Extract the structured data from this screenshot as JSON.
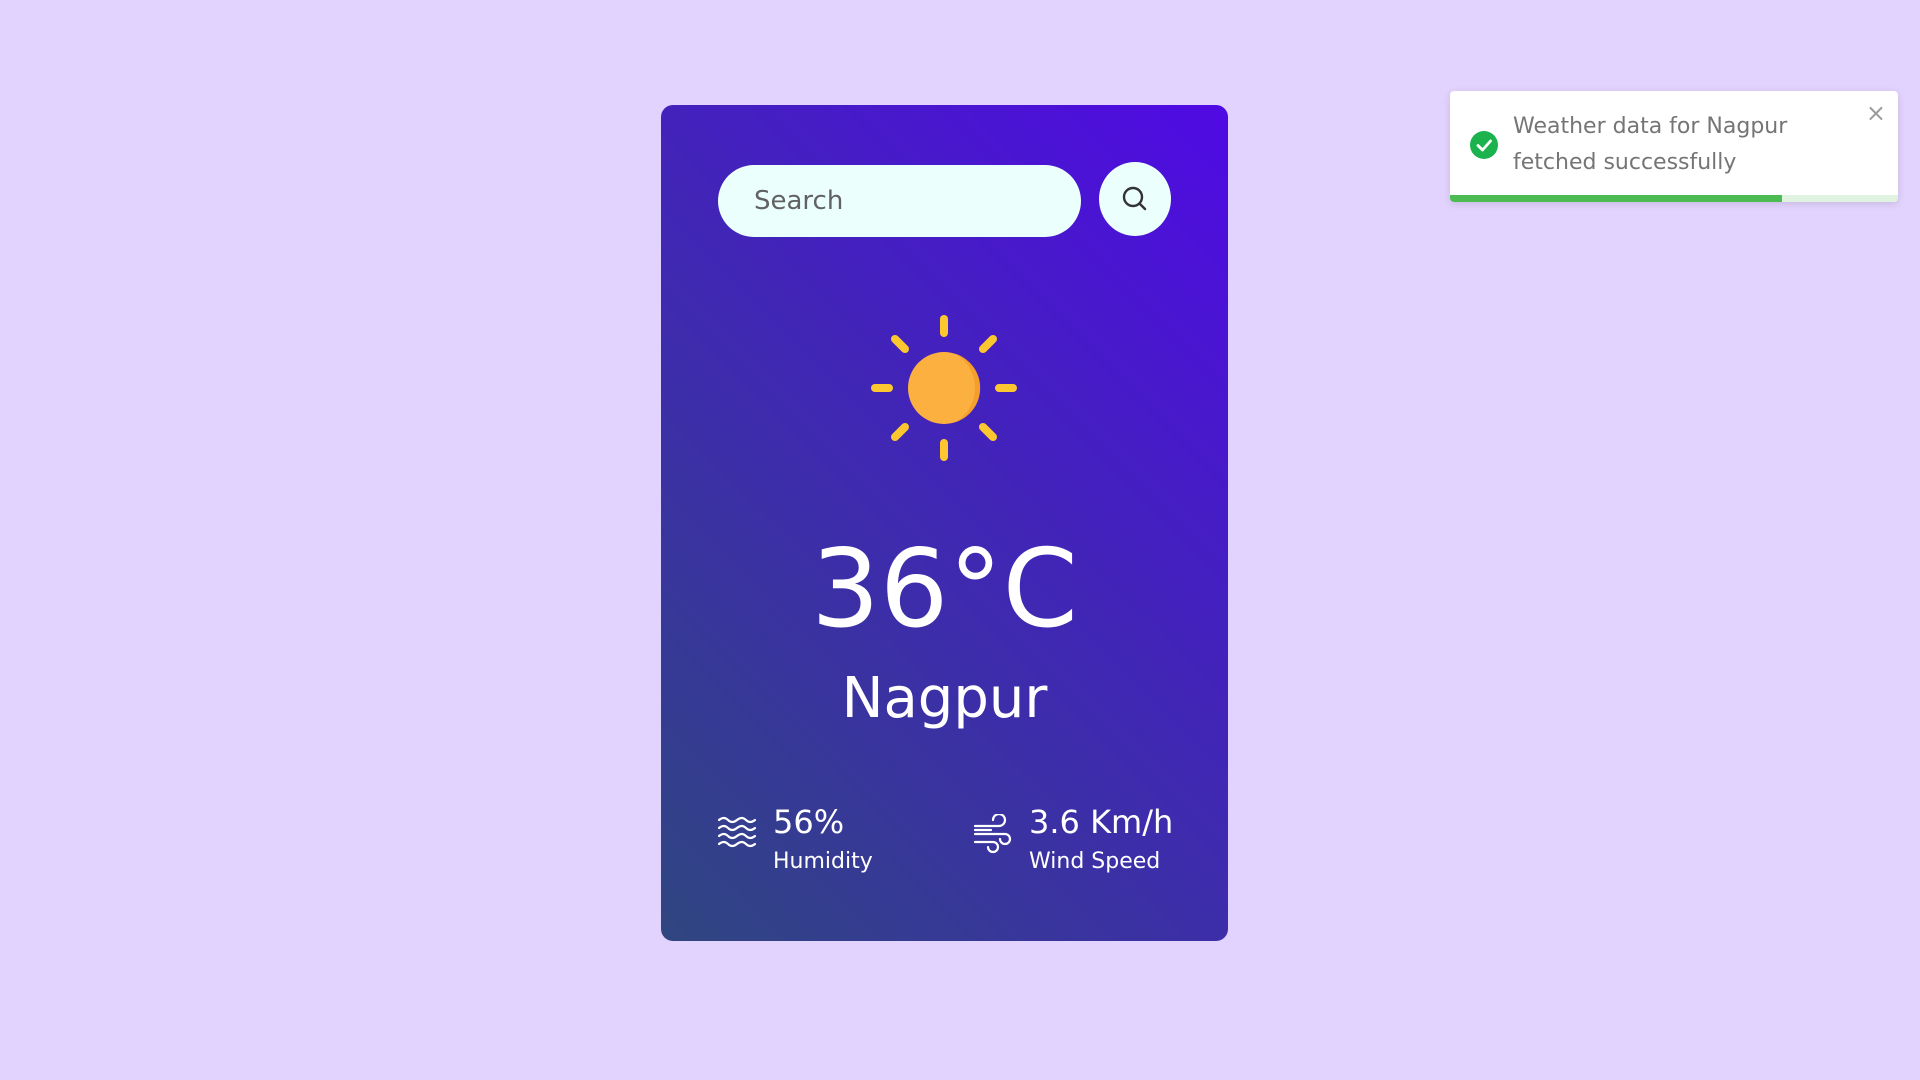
{
  "search": {
    "placeholder": "Search",
    "value": ""
  },
  "weather": {
    "condition_icon": "sun-icon",
    "temperature": "36°C",
    "city": "Nagpur",
    "humidity": {
      "value": "56%",
      "label": "Humidity",
      "icon": "humidity-icon"
    },
    "wind": {
      "value": "3.6 Km/h",
      "label": "Wind Speed",
      "icon": "wind-icon"
    }
  },
  "toast": {
    "message": "Weather data for Nagpur fetched successfully",
    "status_icon": "check-circle-icon",
    "close_icon": "close-icon",
    "close_label": "×",
    "progress": 0.74,
    "color": "#1cb34f"
  },
  "colors": {
    "background": "#e2d3fe",
    "card_gradient_start": "#2f4680",
    "card_gradient_end": "#500ae4",
    "sun_core": "#fbb040",
    "sun_rays": "#fdc82f"
  }
}
